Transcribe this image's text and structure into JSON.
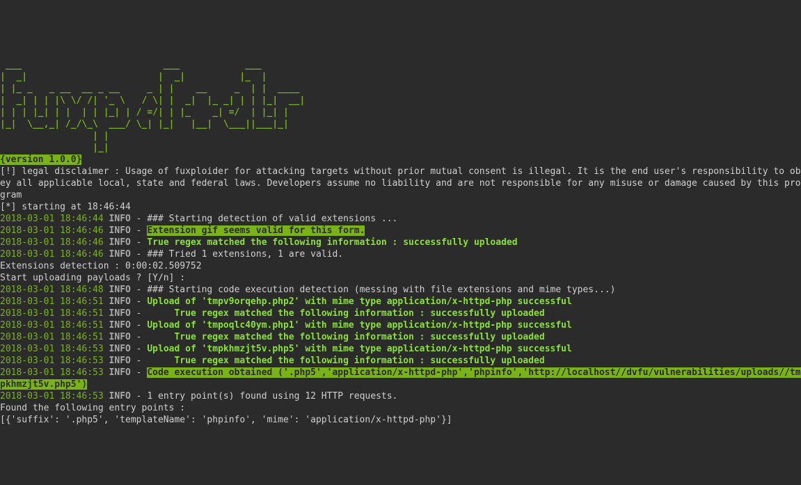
{
  "banner": {
    "ascii": " ___                          ___            ___        \n|  _|                        |  _|          |_  |       \n| |_ _   _ __  __ _ __     _ | |    __     _  | |  ____ \n|  _| | | |\\ \\/ /| '_ \\   / \\| |  _|  |_ _| | | |_|  __|\n| | | |_| | |  | | |_| | / =/| | |_    _| =/  | |_| |   \n|_|  \\__,_| /_/\\_\\  ___/ \\_| |_|   |__|  \\___||___|_|   \n                 | |                                    \n                 |_|                                    ",
    "version_badge": "{version 1.0.0}"
  },
  "disclaimer": {
    "prefix": "[!] legal disclaimer : ",
    "body": "Usage of fuxploider for attacking targets without prior mutual consent is illegal. It is the end user's responsibility to obey all applicable local, state and federal laws. Developers assume no liability and are not responsible for any misuse or damage caused by this program"
  },
  "starting_line": "[*] starting at 18:46:44",
  "log": [
    {
      "ts": "2018-03-01 18:46:44",
      "level": "INFO",
      "sep": " - ",
      "msg": "### Starting detection of valid extensions ...",
      "style": "white"
    },
    {
      "ts": "2018-03-01 18:46:46",
      "level": "INFO",
      "sep": " - ",
      "msg": "Extension gif seems valid for this form.",
      "style": "inv-green"
    },
    {
      "ts": "2018-03-01 18:46:46",
      "level": "INFO",
      "sep": " - ",
      "msg": "True regex matched the following information : successfully uploaded",
      "style": "bright-green-bold"
    },
    {
      "ts": "2018-03-01 18:46:46",
      "level": "INFO",
      "sep": " - ",
      "msg": "### Tried 1 extensions, 1 are valid.",
      "style": "white"
    }
  ],
  "mid": {
    "ext_detection": "Extensions detection : 0:00:02.509752",
    "prompt": "Start uploading payloads ? [Y/n] :"
  },
  "log2": [
    {
      "ts": "2018-03-01 18:46:48",
      "level": "INFO",
      "sep": " - ",
      "msg": "### Starting code execution detection (messing with file extensions and mime types...)",
      "style": "white"
    },
    {
      "ts": "2018-03-01 18:46:51",
      "level": "INFO",
      "sep": " - ",
      "msg": "Upload of 'tmpv9orqehp.php2' with mime type application/x-httpd-php successful",
      "style": "bright-green-bold"
    },
    {
      "ts": "2018-03-01 18:46:51",
      "level": "INFO",
      "sep": " -      ",
      "msg": "True regex matched the following information : successfully uploaded",
      "style": "bright-green-bold"
    },
    {
      "ts": "2018-03-01 18:46:51",
      "level": "INFO",
      "sep": " - ",
      "msg": "Upload of 'tmpoqlc40ym.php1' with mime type application/x-httpd-php successful",
      "style": "bright-green-bold"
    },
    {
      "ts": "2018-03-01 18:46:51",
      "level": "INFO",
      "sep": " -      ",
      "msg": "True regex matched the following information : successfully uploaded",
      "style": "bright-green-bold"
    },
    {
      "ts": "2018-03-01 18:46:53",
      "level": "INFO",
      "sep": " - ",
      "msg": "Upload of 'tmpkhmzjt5v.php5' with mime type application/x-httpd-php successful",
      "style": "bright-green-bold"
    },
    {
      "ts": "2018-03-01 18:46:53",
      "level": "INFO",
      "sep": " -      ",
      "msg": "True regex matched the following information : successfully uploaded",
      "style": "bright-green-bold"
    },
    {
      "ts": "2018-03-01 18:46:53",
      "level": "INFO",
      "sep": " - ",
      "msg": "Code execution obtained ('.php5','application/x-httpd-php','phpinfo','http://localhost//dvfu/vulnerabilities/uploads//tmpkhmzjt5v.php5')",
      "style": "inv-green-bright"
    }
  ],
  "gap": "",
  "log3": [
    {
      "ts": "2018-03-01 18:46:53",
      "level": "INFO",
      "sep": " - ",
      "msg": "1 entry point(s) found using 12 HTTP requests.",
      "style": "white"
    }
  ],
  "footer": {
    "found": "Found the following entry points :",
    "list": "[{'suffix': '.php5', 'templateName': 'phpinfo', 'mime': 'application/x-httpd-php'}]"
  }
}
